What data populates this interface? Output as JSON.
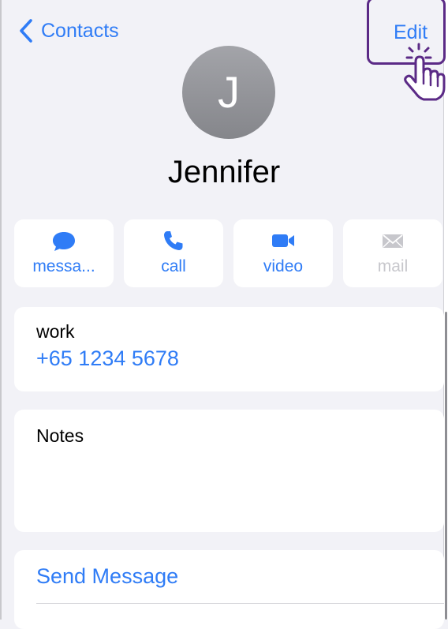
{
  "nav": {
    "back_label": "Contacts",
    "edit_label": "Edit"
  },
  "contact": {
    "initial": "J",
    "name": "Jennifer"
  },
  "actions": [
    {
      "label": "messa...",
      "icon": "message-icon",
      "enabled": true
    },
    {
      "label": "call",
      "icon": "phone-icon",
      "enabled": true
    },
    {
      "label": "video",
      "icon": "video-icon",
      "enabled": true
    },
    {
      "label": "mail",
      "icon": "mail-icon",
      "enabled": false
    }
  ],
  "phone": {
    "label": "work",
    "number": "+65 1234 5678"
  },
  "notes": {
    "label": "Notes"
  },
  "bottom_actions": {
    "send_message": "Send Message"
  },
  "colors": {
    "accent": "#2f7cf6",
    "background": "#f2f2f7",
    "highlight": "#5b2a86"
  }
}
